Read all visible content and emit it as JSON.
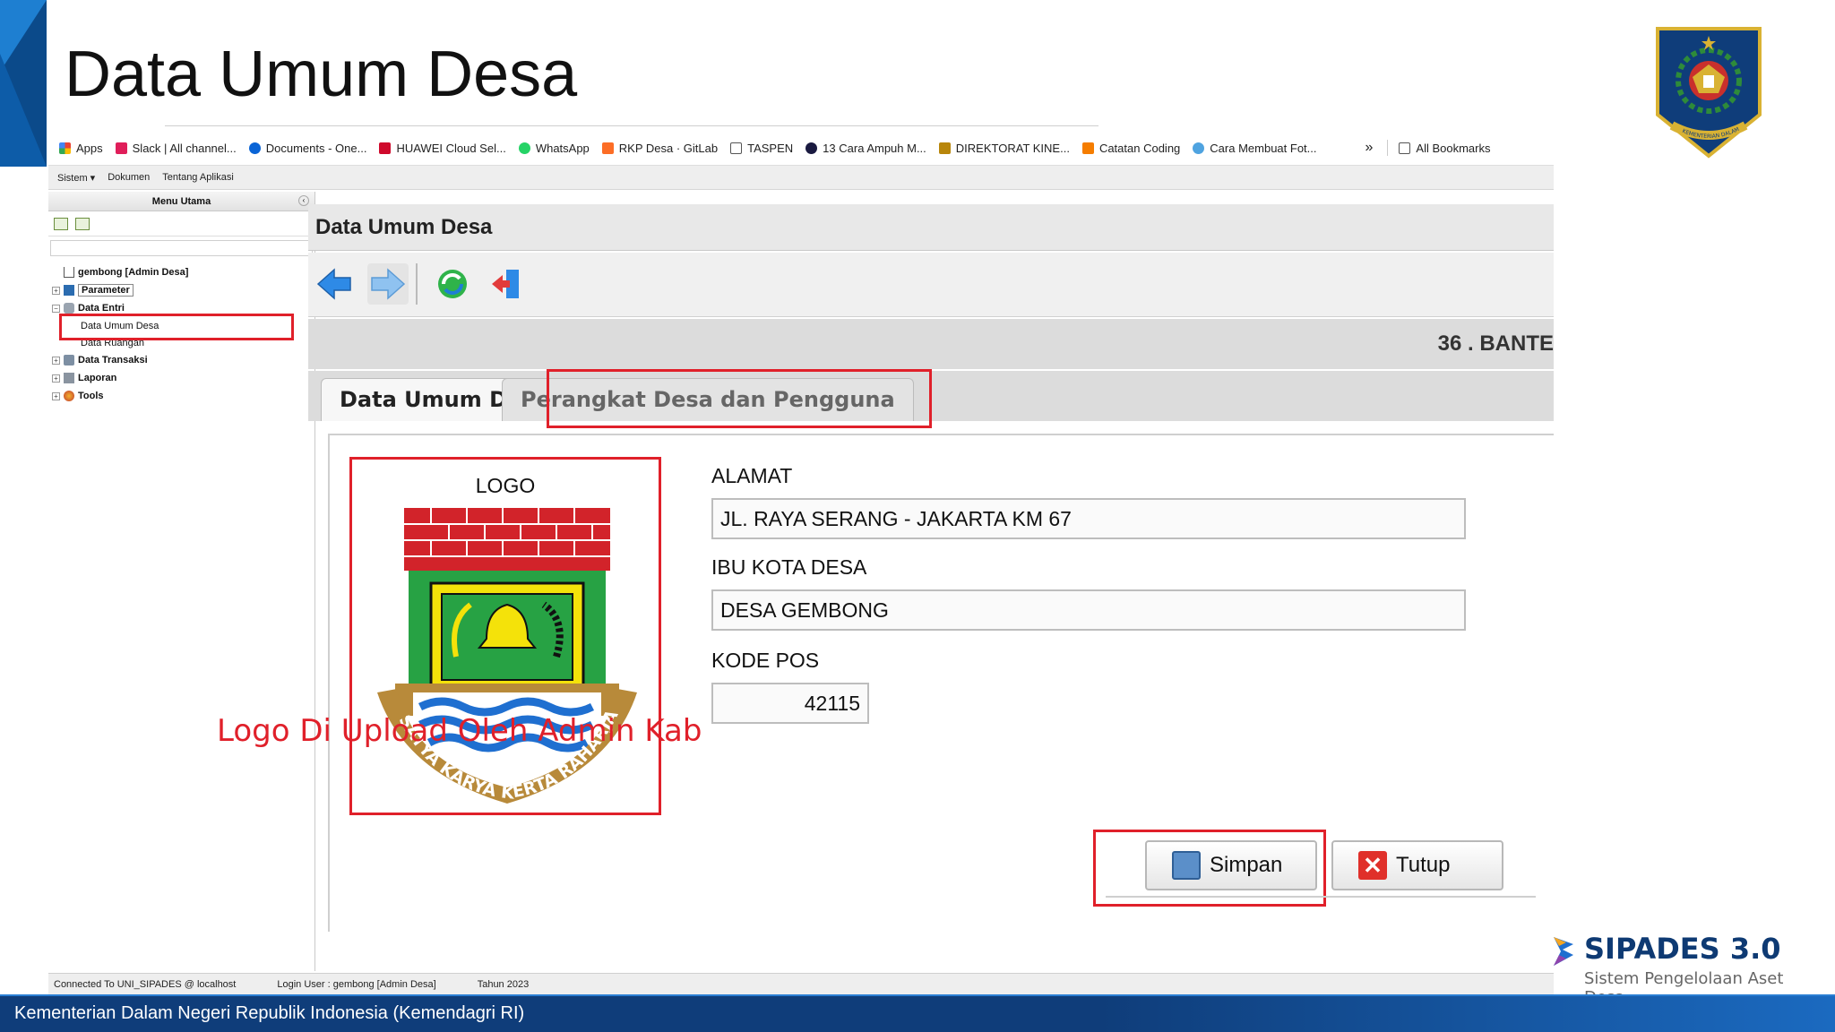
{
  "slide": {
    "title": "Data Umum Desa",
    "footer": "Kementerian Dalam Negeri Republik Indonesia (Kemendagri RI)",
    "brand_name": "SIPADES 3.0",
    "brand_tagline": "Sistem Pengelolaan Aset Desa",
    "annotation": "Logo Di Upload Oleh Admin Kab",
    "emblem_text": "KEMENTERIAN DALAM NEGERI"
  },
  "bookmarks": {
    "items": [
      {
        "label": "Apps",
        "icon": "apps-grid-icon",
        "color": "#ea4335"
      },
      {
        "label": "Slack | All channel...",
        "icon": "slack-icon",
        "color": "#e01e5a"
      },
      {
        "label": "Documents - One...",
        "icon": "onedrive-cloud-icon",
        "color": "#0a64d6"
      },
      {
        "label": "HUAWEI Cloud Sel...",
        "icon": "huawei-icon",
        "color": "#cf0a2c"
      },
      {
        "label": "WhatsApp",
        "icon": "whatsapp-icon",
        "color": "#25d366"
      },
      {
        "label": "RKP Desa · GitLab",
        "icon": "gitlab-icon",
        "color": "#fc6d26"
      },
      {
        "label": "TASPEN",
        "icon": "folder-icon",
        "color": "#555555"
      },
      {
        "label": "13 Cara Ampuh M...",
        "icon": "site-favicon-icon",
        "color": "#1a1a40"
      },
      {
        "label": "DIREKTORAT KINE...",
        "icon": "garuda-icon",
        "color": "#b8860b"
      },
      {
        "label": "Catatan Coding",
        "icon": "blogger-icon",
        "color": "#f57d00"
      },
      {
        "label": "Cara Membuat Fot...",
        "icon": "site-favicon-icon",
        "color": "#4fa3e0"
      }
    ],
    "overflow": "»",
    "all_bookmarks": "All Bookmarks"
  },
  "menubar": {
    "sistem": "Sistem ▾",
    "dokumen": "Dokumen",
    "tentang": "Tentang Aplikasi"
  },
  "leftpanel": {
    "title": "Menu Utama",
    "collapse": "‹",
    "root": "gembong [Admin Desa]",
    "nodes": [
      {
        "label": "Parameter",
        "expander": "+"
      },
      {
        "label": "Data Entri",
        "expander": "−"
      },
      {
        "label": "Data Transaksi",
        "expander": "+"
      },
      {
        "label": "Laporan",
        "expander": "+"
      },
      {
        "label": "Tools",
        "expander": "+"
      }
    ],
    "children": [
      "Data Umum Desa",
      "Data Ruangan"
    ]
  },
  "content": {
    "header": "Data Umum Desa",
    "region": "36 . BANTE",
    "tabs": [
      "Data Umum Desa",
      "Perangkat Desa dan Pengguna"
    ]
  },
  "form": {
    "logo_label": "LOGO",
    "logo_motto": "SATYA KARYA KERTA RAHARJA",
    "alamat_label": "ALAMAT",
    "alamat_value": "JL. RAYA SERANG - JAKARTA KM 67",
    "ibukota_label": "IBU KOTA DESA",
    "ibukota_value": "DESA GEMBONG",
    "kodepos_label": "KODE POS",
    "kodepos_value": "42115"
  },
  "buttons": {
    "save": "Simpan",
    "close": "Tutup"
  },
  "statusbar": {
    "connection": "Connected To UNI_SIPADES @ localhost",
    "user": "Login User : gembong [Admin Desa]",
    "year": "Tahun 2023"
  },
  "colors": {
    "annotation_red": "#e0202a",
    "footer_blue": "#0f3d7a",
    "brand_blue": "#0e3a73"
  }
}
